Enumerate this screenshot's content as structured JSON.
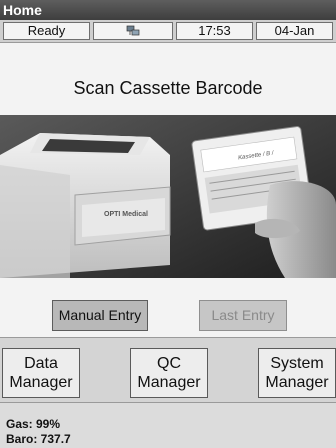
{
  "title": "Home",
  "status": {
    "state": "Ready",
    "network_icon": "network-icon",
    "time": "17:53",
    "date": "04-Jan"
  },
  "main": {
    "prompt": "Scan Cassette Barcode",
    "photo": {
      "brand": "OPTI Medical",
      "cassette_label": "Kassette / B /"
    },
    "manual_entry_label": "Manual Entry",
    "last_entry_label": "Last Entry"
  },
  "nav": {
    "data_manager": [
      "Data",
      "Manager"
    ],
    "qc_manager": [
      "QC",
      "Manager"
    ],
    "system_manager": [
      "System",
      "Manager"
    ]
  },
  "readings": {
    "gas": "Gas: 99%",
    "baro": "Baro: 737.7"
  }
}
